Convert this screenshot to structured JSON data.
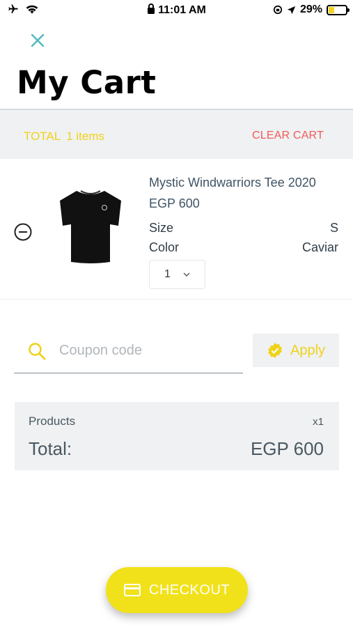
{
  "status_bar": {
    "time": "11:01 AM",
    "battery_percent": "29%",
    "battery_level": 0.29,
    "icons": [
      "airplane-icon",
      "wifi-icon",
      "lock-icon",
      "orientation-lock-icon",
      "location-arrow-icon",
      "battery-icon"
    ]
  },
  "header": {
    "title": "My Cart",
    "close_icon": "close-icon"
  },
  "summary_bar": {
    "total_label": "TOTAL",
    "items_count": "1 items",
    "clear_cart": "CLEAR CART"
  },
  "cart_items": [
    {
      "name": "Mystic Windwarriors Tee 2020",
      "price": "EGP 600",
      "size_label": "Size",
      "size_value": "S",
      "color_label": "Color",
      "color_value": "Caviar",
      "quantity": "1"
    }
  ],
  "coupon": {
    "placeholder": "Coupon code",
    "value": "",
    "apply_label": "Apply"
  },
  "order_summary": {
    "products_label": "Products",
    "products_qty": "x1",
    "total_label": "Total:",
    "total_value": "EGP 600"
  },
  "checkout": {
    "label": "CHECKOUT"
  },
  "colors": {
    "accent_yellow": "#f0d21a",
    "clear_red": "#f25a5a",
    "panel_gray": "#eff1f2",
    "close_teal": "#4fb8bd"
  }
}
